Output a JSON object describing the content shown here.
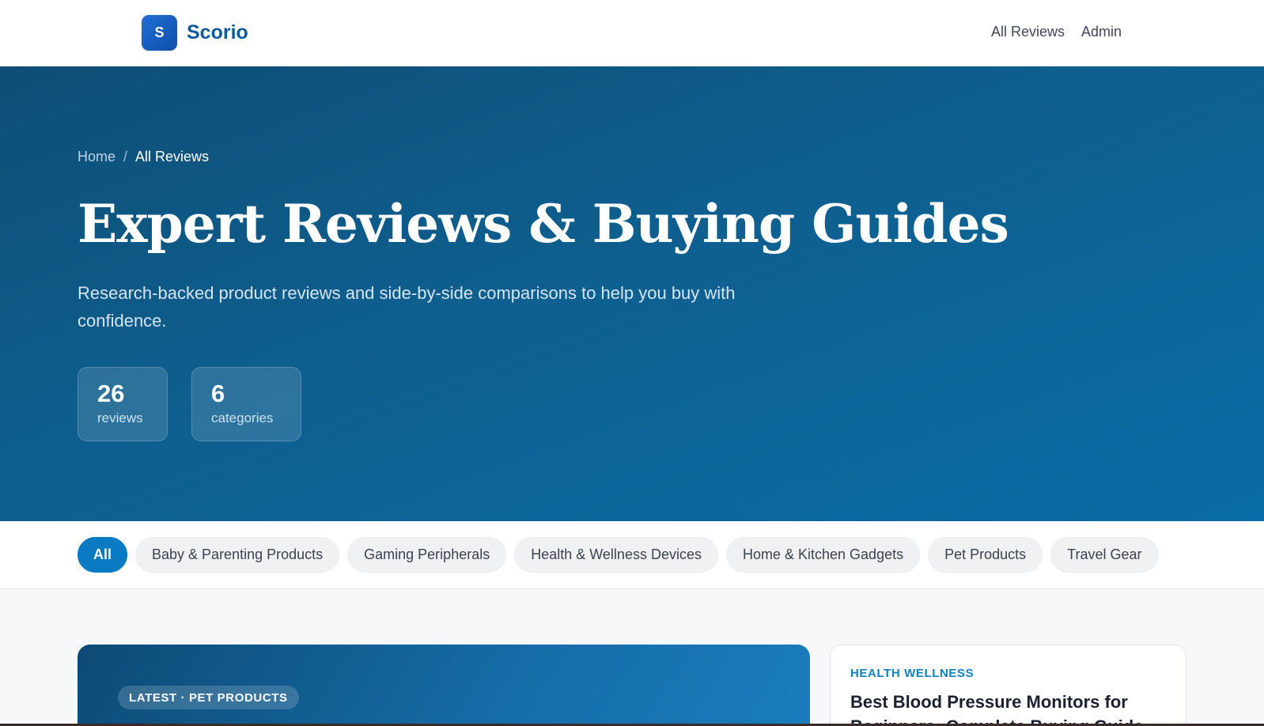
{
  "brand": {
    "logo_letter": "S",
    "name": "Scorio"
  },
  "topnav": [
    {
      "label": "All Reviews"
    },
    {
      "label": "Admin"
    }
  ],
  "breadcrumb": {
    "home": "Home",
    "separator": "/",
    "current": "All Reviews"
  },
  "hero": {
    "title": "Expert Reviews & Buying Guides",
    "subtitle": "Research-backed product reviews and side-by-side comparisons to help you buy with confidence.",
    "stats": [
      {
        "value": "26",
        "label": "reviews"
      },
      {
        "value": "6",
        "label": "categories"
      }
    ]
  },
  "filters": [
    {
      "label": "All",
      "active": true
    },
    {
      "label": "Baby & Parenting Products",
      "active": false
    },
    {
      "label": "Gaming Peripherals",
      "active": false
    },
    {
      "label": "Health & Wellness Devices",
      "active": false
    },
    {
      "label": "Home & Kitchen Gadgets",
      "active": false
    },
    {
      "label": "Pet Products",
      "active": false
    },
    {
      "label": "Travel Gear",
      "active": false
    }
  ],
  "featured": {
    "badge": "LATEST · PET PRODUCTS"
  },
  "side_card": {
    "category": "HEALTH WELLNESS",
    "title": "Best Blood Pressure Monitors for Beginners: Complete Buying Guide"
  },
  "colors": {
    "brand": "#0e5a9a",
    "hero_bg": "#0e5f8f",
    "accent": "#0a7bc2"
  }
}
